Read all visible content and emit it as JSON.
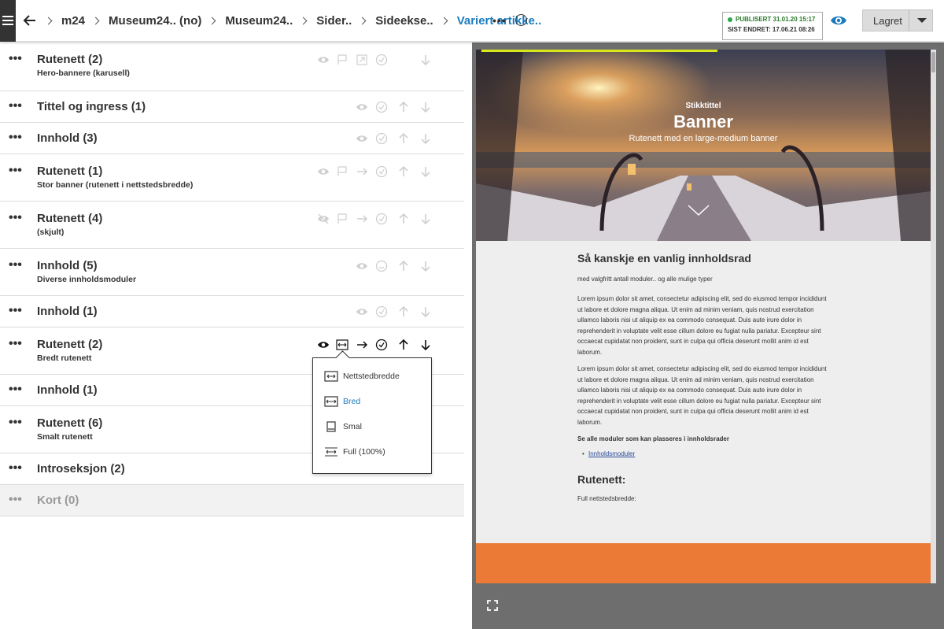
{
  "header": {
    "breadcrumbs": [
      "m24",
      "Museum24.. (no)",
      "Museum24..",
      "Sider..",
      "Sideekse..",
      "Variert artikke.."
    ],
    "more_label": "•••",
    "status_published": "PUBLISERT 31.01.20 15:17",
    "status_edited": "SIST ENDRET: 17.06.21 08:26",
    "save_label": "Lagret"
  },
  "rows": [
    {
      "title": "Rutenett (2)",
      "sub": "Hero-bannere (karusell)"
    },
    {
      "title": "Tittel og ingress (1)",
      "sub": ""
    },
    {
      "title": "Innhold (3)",
      "sub": ""
    },
    {
      "title": "Rutenett (1)",
      "sub": "Stor banner (rutenett i nettstedsbredde)"
    },
    {
      "title": "Rutenett (4)",
      "sub": "(skjult)"
    },
    {
      "title": "Innhold (5)",
      "sub": "Diverse innholdsmoduler"
    },
    {
      "title": "Innhold (1)",
      "sub": ""
    },
    {
      "title": "Rutenett (2)",
      "sub": "Bredt rutenett"
    },
    {
      "title": "Innhold (1)",
      "sub": ""
    },
    {
      "title": "Rutenett (6)",
      "sub": "Smalt rutenett"
    },
    {
      "title": "Introseksjon (2)",
      "sub": ""
    },
    {
      "title": "Kort (0)",
      "sub": ""
    }
  ],
  "width_menu": {
    "options": [
      "Nettstedbredde",
      "Bred",
      "Smal",
      "Full (100%)"
    ],
    "selected": "Bred"
  },
  "preview": {
    "hero_kicker": "Stikktittel",
    "hero_title": "Banner",
    "hero_sub": "Rutenett med en large-medium banner",
    "heading": "Så kanskje en vanlig innholdsrad",
    "lead": "med valgfritt antall moduler.. og alle mulige typer",
    "para1": "Lorem ipsum dolor sit amet, consectetur adipiscing elit, sed do eiusmod tempor incididunt ut labore et dolore magna aliqua. Ut enim ad minim veniam, quis nostrud exercitation ullamco laboris nisi ut aliquip ex ea commodo consequat. Duis aute irure dolor in reprehenderit in voluptate velit esse cillum dolore eu fugiat nulla pariatur. Excepteur sint occaecat cupidatat non proident, sunt in culpa qui officia deserunt mollit anim id est laborum.",
    "para2": "Lorem ipsum dolor sit amet, consectetur adipiscing elit, sed do eiusmod tempor incididunt ut labore et dolore magna aliqua. Ut enim ad minim veniam, quis nostrud exercitation ullamco laboris nisi ut aliquip ex ea commodo consequat. Duis aute irure dolor in reprehenderit in voluptate velit esse cillum dolore eu fugiat nulla pariatur. Excepteur sint occaecat cupidatat non proident, sunt in culpa qui officia deserunt mollit anim id est laborum.",
    "modules_bold": "Se alle moduler som kan plasseres i innholdsrader",
    "modules_link": "Innholdsmoduler",
    "grid_heading": "Rutenett:",
    "grid_sub": "Full nettstedsbredde:"
  },
  "colors": {
    "accent": "#1a7bbf",
    "published": "#2aa84a",
    "orange": "#ec7a37"
  }
}
